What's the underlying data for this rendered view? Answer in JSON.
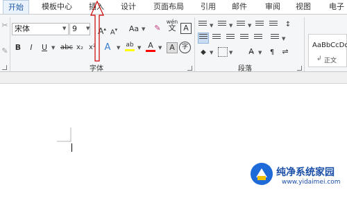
{
  "tabs": [
    "开始",
    "模板中心",
    "插入",
    "设计",
    "页面布局",
    "引用",
    "邮件",
    "审阅",
    "视图",
    "电子"
  ],
  "font": {
    "name": "宋体",
    "size": "9",
    "grow_label": "A",
    "shrink_label": "A",
    "change_case_label": "Aa",
    "pinyin_top": "wén",
    "pinyin_char": "文",
    "char_border_label": "A",
    "bold": "B",
    "italic": "I",
    "underline": "U",
    "strikethrough": "abc",
    "subscript": "x₂",
    "superscript": "x²",
    "highlight_label": "ab",
    "font_color_label": "A",
    "enclose_char": "字",
    "group_label": "字体"
  },
  "paragraph": {
    "group_label": "段落"
  },
  "styles": {
    "sample": "AaBbCcDd",
    "name": "正文",
    "mark": "↲"
  },
  "watermark": {
    "text": "纯净系统家园",
    "url": "www.yidaimei.com"
  },
  "colors": {
    "accent": "#1e5aa8",
    "highlight": "#ffff00",
    "font_color": "#ff0000",
    "annotation": "#cc0000"
  }
}
